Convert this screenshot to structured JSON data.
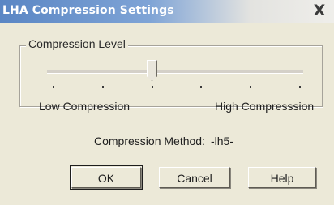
{
  "window": {
    "title": "LHA Compression Settings",
    "close_glyph": "X"
  },
  "compression_level": {
    "group_label": "Compression Level",
    "slider": {
      "tick_count": 6,
      "selected_tick_index": 2,
      "low_label": "Low Compression",
      "high_label": "High Compresssion"
    }
  },
  "method": {
    "label": "Compression Method:",
    "value": "-lh5-"
  },
  "buttons": {
    "ok": "OK",
    "cancel": "Cancel",
    "help": "Help"
  }
}
